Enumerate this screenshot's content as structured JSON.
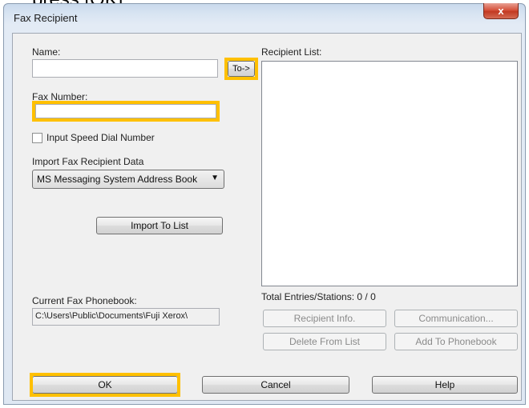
{
  "instruction_text": "press [OK].",
  "window": {
    "title": "Fax Recipient",
    "close_glyph": "x"
  },
  "name": {
    "label": "Name:",
    "value": ""
  },
  "to_button": {
    "label": "To->"
  },
  "fax_number": {
    "label": "Fax Number:",
    "value": ""
  },
  "speed_dial": {
    "label": "Input Speed Dial Number",
    "checked": false
  },
  "import_data": {
    "label": "Import Fax Recipient Data",
    "selected": "MS Messaging System Address Book"
  },
  "import_button": {
    "label": "Import To List"
  },
  "phonebook": {
    "label": "Current Fax Phonebook:",
    "value": "C:\\Users\\Public\\Documents\\Fuji Xerox\\"
  },
  "recipient_list": {
    "label": "Recipient List:",
    "items": []
  },
  "totals": {
    "label": "Total Entries/Stations: 0 / 0"
  },
  "actions": {
    "recipient_info": "Recipient Info.",
    "communication": "Communication...",
    "delete_from_list": "Delete From List",
    "add_to_phonebook": "Add To Phonebook"
  },
  "footer": {
    "ok": "OK",
    "cancel": "Cancel",
    "help": "Help"
  },
  "colors": {
    "highlight": "#ffc000",
    "close_button": "#c9452d"
  }
}
